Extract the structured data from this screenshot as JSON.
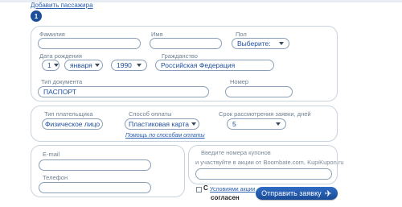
{
  "header": {
    "add_passenger": "Добавить пассажира",
    "passenger_number": "1"
  },
  "passenger": {
    "surname_label": "Фамилия",
    "surname_value": "",
    "name_label": "Имя",
    "name_value": "",
    "gender_label": "Пол",
    "gender_value": "Выберите:",
    "birth_label": "Дата рождения",
    "birth_day": "1",
    "birth_month": "января",
    "birth_year": "1990",
    "citizenship_label": "Гражданство",
    "citizenship_value": "Российская Федерация",
    "doc_type_label": "Тип документа",
    "doc_type_value": "ПАСПОРТ",
    "doc_number_label": "Номер",
    "doc_number_value": ""
  },
  "payment": {
    "payer_label": "Тип плательщика",
    "payer_value": "Физическое лицо",
    "method_label": "Способ оплаты",
    "method_value": "Пластиковая карта",
    "term_label": "Срок рассмотрения заявки, дней",
    "term_value": "5",
    "help_link": "Помощь по способам оплаты"
  },
  "contacts": {
    "email_label": "E-mail",
    "email_value": "",
    "phone_label": "Телефон",
    "phone_value": ""
  },
  "promo": {
    "line1": "Введите номера купонов",
    "line2": "и участвуйте в акции от Boombate.com, KupiKupon.ru",
    "value": ""
  },
  "footer": {
    "terms_prefix": "С",
    "terms_link": "Условиями акции",
    "agree": "согласен",
    "submit": "Отправить заявку"
  }
}
